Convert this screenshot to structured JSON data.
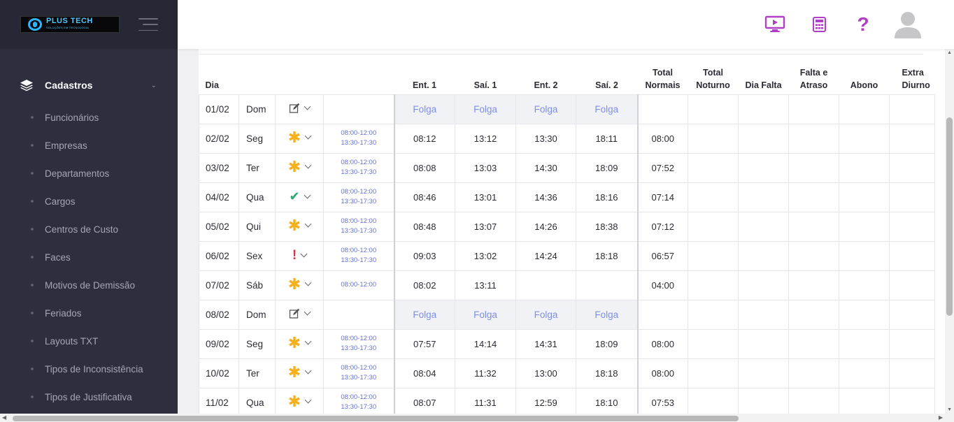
{
  "brand": {
    "name": "PLUS TECH",
    "tagline": "SOLUÇÕES EM TECNOLOGIA"
  },
  "sidebar": {
    "section_label": "Cadastros",
    "items": [
      {
        "label": "Funcionários"
      },
      {
        "label": "Empresas"
      },
      {
        "label": "Departamentos"
      },
      {
        "label": "Cargos"
      },
      {
        "label": "Centros de Custo"
      },
      {
        "label": "Faces"
      },
      {
        "label": "Motivos de Demissão"
      },
      {
        "label": "Feriados"
      },
      {
        "label": "Layouts TXT"
      },
      {
        "label": "Tipos de Inconsistência"
      },
      {
        "label": "Tipos de Justificativa"
      }
    ]
  },
  "topbar": {
    "help_glyph": "?"
  },
  "table": {
    "headers": {
      "dia": "Dia",
      "ent1": "Ent. 1",
      "sai1": "Saí. 1",
      "ent2": "Ent. 2",
      "sai2": "Saí. 2",
      "total_normais_1": "Total",
      "total_normais_2": "Normais",
      "total_noturno_1": "Total",
      "total_noturno_2": "Noturno",
      "dia_falta": "Dia Falta",
      "falta_atraso_1": "Falta e",
      "falta_atraso_2": "Atraso",
      "abono": "Abono",
      "extra_1": "Extra",
      "extra_2": "Diurno"
    },
    "rows": [
      {
        "dia": "01/02",
        "dow": "Dom",
        "status": "edit",
        "h1": "",
        "h2": "",
        "e1": "Folga",
        "s1": "Folga",
        "e2": "Folga",
        "s2": "Folga",
        "folga": true,
        "total": ""
      },
      {
        "dia": "02/02",
        "dow": "Seg",
        "status": "asterisk",
        "h1": "08:00-12:00",
        "h2": "13:30-17:30",
        "e1": "08:12",
        "s1": "13:12",
        "e2": "13:30",
        "s2": "18:11",
        "folga": false,
        "total": "08:00"
      },
      {
        "dia": "03/02",
        "dow": "Ter",
        "status": "asterisk",
        "h1": "08:00-12:00",
        "h2": "13:30-17:30",
        "e1": "08:08",
        "s1": "13:03",
        "e2": "14:30",
        "s2": "18:09",
        "folga": false,
        "total": "07:52"
      },
      {
        "dia": "04/02",
        "dow": "Qua",
        "status": "check",
        "h1": "08:00-12:00",
        "h2": "13:30-17:30",
        "e1": "08:46",
        "s1": "13:01",
        "e2": "14:36",
        "s2": "18:16",
        "folga": false,
        "total": "07:14"
      },
      {
        "dia": "05/02",
        "dow": "Qui",
        "status": "asterisk",
        "h1": "08:00-12:00",
        "h2": "13:30-17:30",
        "e1": "08:48",
        "s1": "13:07",
        "e2": "14:26",
        "s2": "18:38",
        "folga": false,
        "total": "07:12"
      },
      {
        "dia": "06/02",
        "dow": "Sex",
        "status": "exclamation",
        "h1": "08:00-12:00",
        "h2": "13:30-17:30",
        "e1": "09:03",
        "s1": "13:02",
        "e2": "14:24",
        "s2": "18:18",
        "folga": false,
        "total": "06:57"
      },
      {
        "dia": "07/02",
        "dow": "Sáb",
        "status": "asterisk",
        "h1": "08:00-12:00",
        "h2": "",
        "e1": "08:02",
        "s1": "13:11",
        "e2": "",
        "s2": "",
        "folga": false,
        "total": "04:00"
      },
      {
        "dia": "08/02",
        "dow": "Dom",
        "status": "edit",
        "h1": "",
        "h2": "",
        "e1": "Folga",
        "s1": "Folga",
        "e2": "Folga",
        "s2": "Folga",
        "folga": true,
        "total": ""
      },
      {
        "dia": "09/02",
        "dow": "Seg",
        "status": "asterisk",
        "h1": "08:00-12:00",
        "h2": "13:30-17:30",
        "e1": "07:57",
        "s1": "14:14",
        "e2": "14:31",
        "s2": "18:09",
        "folga": false,
        "total": "08:00"
      },
      {
        "dia": "10/02",
        "dow": "Ter",
        "status": "asterisk",
        "h1": "08:00-12:00",
        "h2": "13:30-17:30",
        "e1": "08:04",
        "s1": "11:32",
        "e2": "13:00",
        "s2": "18:18",
        "folga": false,
        "total": "08:00"
      },
      {
        "dia": "11/02",
        "dow": "Qua",
        "status": "asterisk",
        "h1": "08:00-12:00",
        "h2": "13:30-17:30",
        "e1": "08:07",
        "s1": "11:31",
        "e2": "12:59",
        "s2": "18:10",
        "folga": false,
        "total": "07:53"
      }
    ]
  },
  "colors": {
    "sidebar_bg": "#2d2f3f",
    "accent": "#b13ec6",
    "folga": "#7f8ee6",
    "schedule": "#6472d0"
  }
}
